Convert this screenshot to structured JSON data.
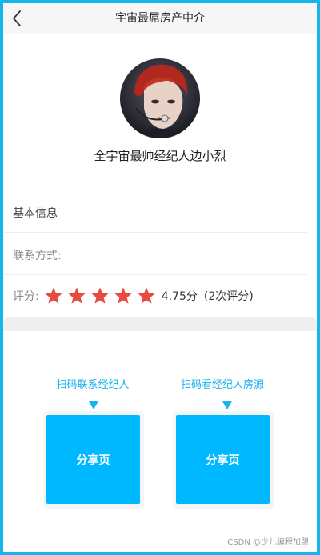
{
  "header": {
    "title": "宇宙最屌房产中介"
  },
  "agent": {
    "name": "全宇宙最帅经纪人边小烈"
  },
  "info": {
    "section_title": "基本信息",
    "contact_label": "联系方式:",
    "rating_label": "评分:",
    "rating_value": 4.75,
    "rating_score_text": "4.75分",
    "rating_count_text": "(2次评分)",
    "star_count": 5,
    "star_color": "#e84a3e"
  },
  "qr": {
    "contact": {
      "caption": "扫码联系经纪人",
      "label": "分享页"
    },
    "listings": {
      "caption": "扫码看经纪人房源",
      "label": "分享页"
    }
  },
  "watermark": "CSDN @少儿编程加盟",
  "colors": {
    "accent": "#19b2ee",
    "qr_box": "#00b8ff",
    "frame": "#17b4ee"
  }
}
